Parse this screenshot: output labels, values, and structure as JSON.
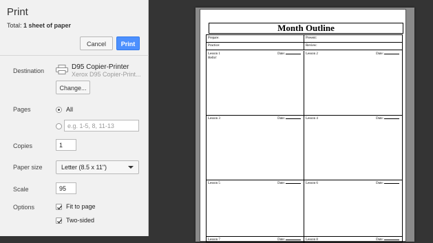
{
  "print_panel": {
    "title": "Print",
    "total_label": "Total:",
    "total_value": "1 sheet of paper",
    "cancel_label": "Cancel",
    "print_label": "Print",
    "destination": {
      "label": "Destination",
      "printer_name": "D95 Copier-Printer",
      "printer_sub": "Xerox D95 Copier-Print...",
      "change_label": "Change..."
    },
    "pages": {
      "label": "Pages",
      "all_label": "All",
      "range_placeholder": "e.g. 1-5, 8, 11-13",
      "selected": "All"
    },
    "copies": {
      "label": "Copies",
      "value": "1"
    },
    "paper_size": {
      "label": "Paper size",
      "value": "Letter (8.5 x 11\")"
    },
    "scale": {
      "label": "Scale",
      "value": "95"
    },
    "options": {
      "label": "Options",
      "fit_to_page": "Fit to page",
      "fit_to_page_checked": true,
      "two_sided": "Two-sided",
      "two_sided_checked": true
    }
  },
  "preview": {
    "title": "Month Outline",
    "prepare": "Prepare:",
    "present": "Present:",
    "practice": "Practice:",
    "review": "Review:",
    "date_label": "Date:",
    "lessons": [
      {
        "label": "Lesson 1",
        "note": "Hello!"
      },
      {
        "label": "Lesson 2",
        "note": ""
      },
      {
        "label": "Lesson 3",
        "note": ""
      },
      {
        "label": "Lesson 4",
        "note": ""
      },
      {
        "label": "Lesson 5",
        "note": ""
      },
      {
        "label": "Lesson 6",
        "note": ""
      },
      {
        "label": "Lesson 7",
        "note": ""
      },
      {
        "label": "Lesson 8",
        "note": ""
      }
    ]
  },
  "colors": {
    "print_button": "#4d90fe",
    "panel_background": "#f1f1f1",
    "preview_background": "#343434"
  },
  "icons": {
    "printer": "printer-icon",
    "checkbox": "checkmark-icon",
    "select_caret": "caret-down-icon"
  }
}
